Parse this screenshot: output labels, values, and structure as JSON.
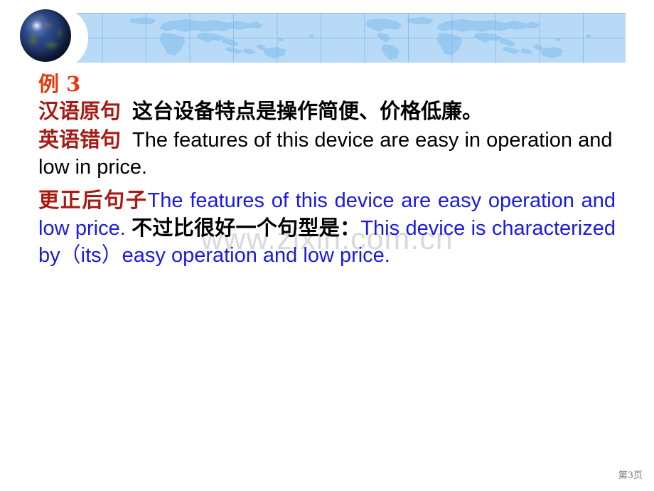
{
  "header": {
    "globe_icon": "globe-icon",
    "banner_color": "#b9daf6",
    "banner_grid_color": "#82b9eb"
  },
  "slide": {
    "example_title": "例 3",
    "rows": {
      "source_label": "汉语原句",
      "source_text": "这台设备特点是操作简便、价格低廉。",
      "wrong_label": "英语错句",
      "wrong_text": "The features of this device are easy in operation and low in price.",
      "corrected_label": "更正后句子",
      "corrected_text_a": "The features of this device are easy operation and low price.",
      "corrected_note_cn": "不过比很好一个句型是：",
      "corrected_text_b": "This device is characterized by（its）easy operation and low price."
    },
    "colors": {
      "title_red": "#e8380d",
      "label_red": "#a71a14",
      "blue": "#1a1ae0",
      "black": "#000000"
    }
  },
  "watermark": {
    "text": "www.zixin.com.cn",
    "color": "#d9d9de"
  },
  "footer": {
    "page_label": "第3页"
  }
}
